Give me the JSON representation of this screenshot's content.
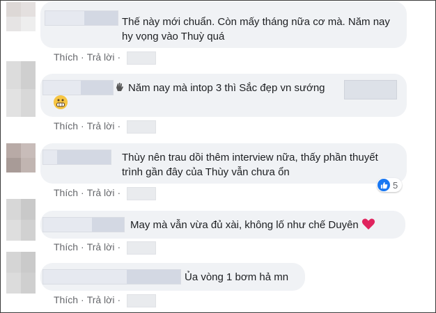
{
  "actions": {
    "like": "Thích",
    "reply": "Trả lời",
    "separator": "·"
  },
  "comments": [
    {
      "text": "Thế này mới chuẩn. Còn mấy tháng nữa cơ mà. Năm nay hy vọng vào Thuỳ quá"
    },
    {
      "text": "Năm nay mà intop 3 thì Sắc đẹp vn sướng",
      "icon": "waving-hand-icon",
      "trailing_icon": "grimacing-face-icon"
    },
    {
      "text": "Thùy nên trau dồi thêm interview nữa, thấy phần thuyết trình gần đây của Thùy vẫn chưa ổn",
      "reaction_count": "5",
      "reaction_icon": "like-icon",
      "reaction_color": "#1877f2"
    },
    {
      "text": "May mà vẫn vừa đủ xài, không lố như chế Duyên",
      "trailing_icon": "red-heart-icon",
      "heart_color": "#e0245e"
    },
    {
      "text": "Ủa vòng 1 bơm hả mn"
    }
  ],
  "colors": {
    "bubble": "#f0f2f5",
    "action_text": "#65676b",
    "text": "#1c1e21"
  }
}
